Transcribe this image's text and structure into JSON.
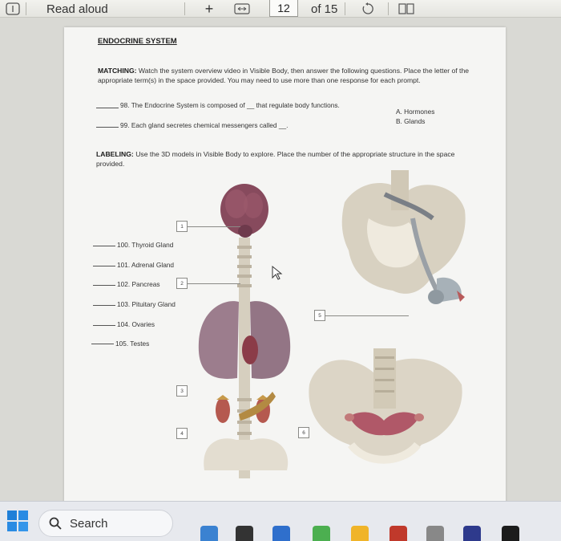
{
  "toolbar": {
    "read_aloud": "Read aloud",
    "add_icon": "+",
    "page_number": "12",
    "page_total": "of 15"
  },
  "document": {
    "title": "ENDOCRINE SYSTEM",
    "matching": {
      "heading": "MATCHING:",
      "instructions": "Watch the system overview video in Visible Body, then answer the following questions. Place the letter of the appropriate term(s) in the space provided. You may need to use more than one response for each prompt.",
      "questions": [
        {
          "text": "98. The Endocrine System is composed of __ that regulate body functions."
        },
        {
          "text": "99. Each gland secretes chemical messengers called __."
        }
      ],
      "options": [
        "A. Hormones",
        "B. Glands"
      ]
    },
    "labeling": {
      "heading": "LABELING:",
      "instructions": "Use the 3D models in Visible Body to explore. Place the number of the appropriate structure in the space provided.",
      "items": [
        "100. Thyroid Gland",
        "101. Adrenal Gland",
        "102. Pancreas",
        "103. Pituitary Gland",
        "104. Ovaries",
        "105. Testes"
      ],
      "figure_labels": [
        "1",
        "2",
        "3",
        "4",
        "5",
        "6"
      ]
    }
  },
  "taskbar": {
    "search_label": "Search"
  },
  "colors": {
    "page": "#f5f5f3",
    "taskbar": "#e7e9ee",
    "brain": "#8a4a5e",
    "lung": "#9c7c8c",
    "bone": "#d8d2c4"
  }
}
